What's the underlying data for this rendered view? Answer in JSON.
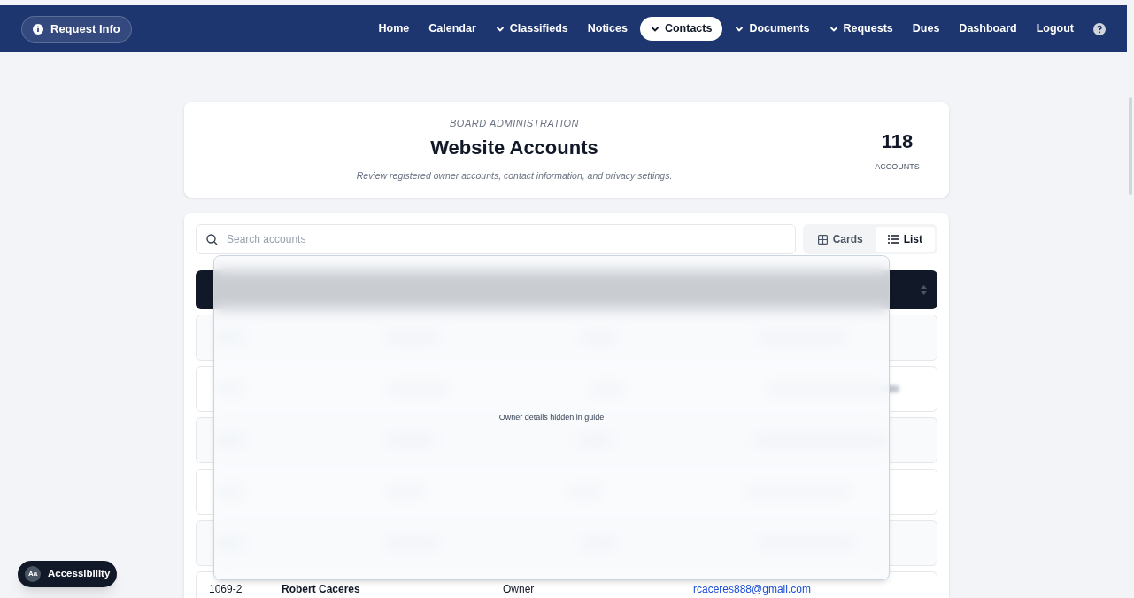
{
  "topbar": {
    "request_button": "Request Info",
    "nav": [
      {
        "label": "Home",
        "dropdown": false,
        "selected": false
      },
      {
        "label": "Calendar",
        "dropdown": false,
        "selected": false
      },
      {
        "label": "Classifieds",
        "dropdown": true,
        "selected": false
      },
      {
        "label": "Notices",
        "dropdown": false,
        "selected": false
      },
      {
        "label": "Contacts",
        "dropdown": true,
        "selected": true
      },
      {
        "label": "Documents",
        "dropdown": true,
        "selected": false
      },
      {
        "label": "Requests",
        "dropdown": true,
        "selected": false
      },
      {
        "label": "Dues",
        "dropdown": false,
        "selected": false
      },
      {
        "label": "Dashboard",
        "dropdown": false,
        "selected": false
      },
      {
        "label": "Logout",
        "dropdown": false,
        "selected": false
      }
    ]
  },
  "header": {
    "eyebrow": "BOARD ADMINISTRATION",
    "title": "Website Accounts",
    "subtitle": "Review registered owner accounts, contact information, and privacy settings.",
    "count": "118",
    "count_label": "ACCOUNTS"
  },
  "toolbar": {
    "search": {
      "placeholder": "Search accounts"
    },
    "views": [
      {
        "label": "Cards",
        "selected": false
      },
      {
        "label": "List",
        "selected": true
      }
    ]
  },
  "overlay": {
    "message": "Owner details hidden in guide"
  },
  "table": {
    "visible_row": {
      "unit": "1069-2",
      "name": "Robert Caceres",
      "type": "Owner",
      "email": "rcaceres888@gmail.com"
    }
  },
  "accessibility_button": {
    "icon_text": "Aa",
    "label": "Accessibility"
  }
}
